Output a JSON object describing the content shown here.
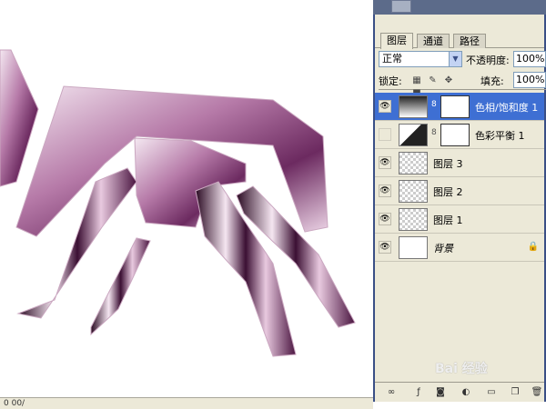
{
  "panel": {
    "tabs": [
      {
        "label": "图层",
        "active": true
      },
      {
        "label": "通道",
        "active": false
      },
      {
        "label": "路径",
        "active": false
      }
    ],
    "blend_mode": "正常",
    "opacity_label": "不透明度:",
    "opacity_value": "100%",
    "lock_label": "锁定:",
    "fill_label": "填充:",
    "fill_value": "100%",
    "layers": [
      {
        "name": "色相/饱和度 1",
        "type": "adjustment",
        "visible": true,
        "selected": true
      },
      {
        "name": "色彩平衡 1",
        "type": "adjustment",
        "visible": false,
        "selected": false
      },
      {
        "name": "图层 3",
        "type": "pixel",
        "visible": true,
        "selected": false
      },
      {
        "name": "图层 2",
        "type": "pixel",
        "visible": true,
        "selected": false
      },
      {
        "name": "图层 1",
        "type": "pixel",
        "visible": true,
        "selected": false
      },
      {
        "name": "背景",
        "type": "background",
        "visible": true,
        "selected": false,
        "locked": true
      }
    ],
    "footer_icons": [
      "link-icon",
      "fx-icon",
      "mask-icon",
      "adjustment-icon",
      "folder-icon",
      "new-layer-icon",
      "trash-icon"
    ]
  },
  "status": {
    "zoom_text": "0 00/"
  },
  "watermark": {
    "text": "Bai 经验",
    "paw": "du"
  },
  "colors": {
    "selection_blue": "#3e6fd3",
    "panel_bg": "#ece9d8",
    "frame_blue": "#3a4f86",
    "shape_purple": "#8a4a7e"
  }
}
